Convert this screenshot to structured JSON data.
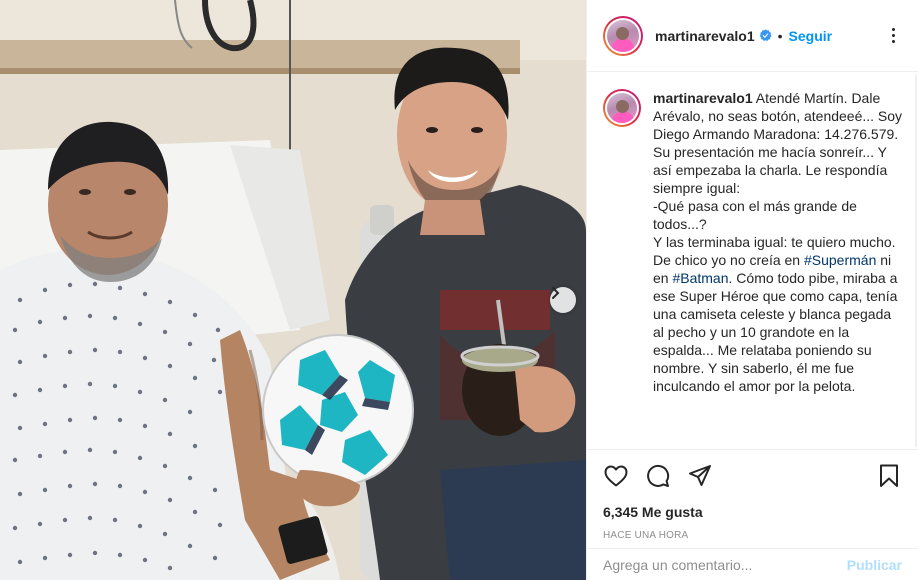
{
  "post": {
    "username": "martinarevalo1",
    "follow_label": "Seguir",
    "bullet": "•",
    "photo_alt": "",
    "carousel_dots": 2
  },
  "caption": {
    "username": "martinarevalo1",
    "lines": [
      "Atendé Martín. Dale Arévalo, no seas botón, atendeeé... Soy Diego Armando Maradona: 14.276.579.",
      "",
      "Su presentación me hacía sonreír... Y así empezaba la charla. Le respondía siempre igual:",
      "-Qué pasa con el más grande de todos...?",
      "Y las terminaba igual: te quiero mucho."
    ],
    "para_part1": "De chico yo no creía en ",
    "tag1": "#Supermán",
    "para_part2": " ni en ",
    "tag2": "#Batman",
    "para_part3": ". Cómo todo pibe, miraba a ese Super Héroe que como capa, tenía una camiseta celeste y blanca pegada al pecho y un 10 grandote en la espalda... Me relataba poniendo su nombre. Y sin saberlo, él me fue inculcando el amor por la pelota."
  },
  "actions": {
    "like_icon": "heart-icon",
    "comment_icon": "comment-icon",
    "share_icon": "paper-plane-icon",
    "save_icon": "bookmark-icon"
  },
  "likes": "6,345 Me gusta",
  "timestamp": "Hace una hora",
  "add_comment": {
    "placeholder": "Agrega un comentario...",
    "publish_label": "Publicar"
  },
  "colors": {
    "link": "#0095f6",
    "hashtag": "#00376b",
    "publish_disabled": "#b2dffc",
    "muted": "#8e8e8e"
  }
}
